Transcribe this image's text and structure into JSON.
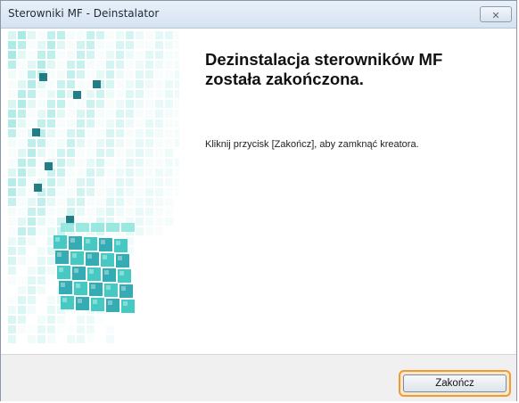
{
  "window": {
    "title": "Sterowniki MF - Deinstalator",
    "close_symbol": "✕"
  },
  "content": {
    "heading_line1": "Dezinstalacja sterowników MF",
    "heading_line2": "została zakończona.",
    "message": "Kliknij przycisk [Zakończ], aby zamknąć kreatora."
  },
  "footer": {
    "finish_label": "Zakończ"
  },
  "colors": {
    "accent_orange": "#ef9b34",
    "cube_teal": "#3dc6c0",
    "cube_dark": "#0e6f78"
  },
  "icons": [
    "close-icon",
    "cube-artwork"
  ]
}
